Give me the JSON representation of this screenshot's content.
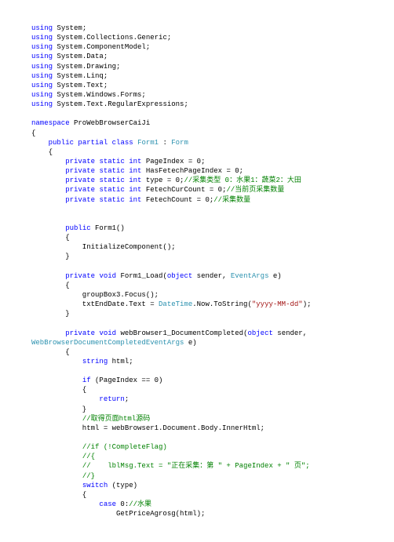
{
  "code": {
    "u1a": "using",
    "u1b": " System;",
    "u2a": "using",
    "u2b": " System.Collections.Generic;",
    "u3a": "using",
    "u3b": " System.ComponentModel;",
    "u4a": "using",
    "u4b": " System.Data;",
    "u5a": "using",
    "u5b": " System.Drawing;",
    "u6a": "using",
    "u6b": " System.Linq;",
    "u7a": "using",
    "u7b": " System.Text;",
    "u8a": "using",
    "u8b": " System.Windows.Forms;",
    "u9a": "using",
    "u9b": " System.Text.RegularExpressions;",
    "ns_a": "namespace",
    "ns_b": " ProWebBrowserCaiJi",
    "ob": "{",
    "cls_1": "    ",
    "cls_2": "public",
    "cls_3": " ",
    "cls_4": "partial",
    "cls_5": " ",
    "cls_6": "class",
    "cls_7": " ",
    "cls_8": "Form1",
    "cls_9": " : ",
    "cls_10": "Form",
    "ob2": "    {",
    "f1_1": "        ",
    "f1_2": "private",
    "f1_3": " ",
    "f1_4": "static",
    "f1_5": " ",
    "f1_6": "int",
    "f1_7": " PageIndex = 0;",
    "f2_1": "        ",
    "f2_2": "private",
    "f2_3": " ",
    "f2_4": "static",
    "f2_5": " ",
    "f2_6": "int",
    "f2_7": " HasFetechPageIndex = 0;",
    "f3_1": "        ",
    "f3_2": "private",
    "f3_3": " ",
    "f3_4": "static",
    "f3_5": " ",
    "f3_6": "int",
    "f3_7": " type = 0;",
    "f3_8": "//采集类型 0：水果1：蔬菜2：大田",
    "f4_1": "        ",
    "f4_2": "private",
    "f4_3": " ",
    "f4_4": "static",
    "f4_5": " ",
    "f4_6": "int",
    "f4_7": " FetechCurCount = 0;",
    "f4_8": "//当前页采集数量",
    "f5_1": "        ",
    "f5_2": "private",
    "f5_3": " ",
    "f5_4": "static",
    "f5_5": " ",
    "f5_6": "int",
    "f5_7": " FetechCount = 0;",
    "f5_8": "//采集数量",
    "ctor_1": "        ",
    "ctor_2": "public",
    "ctor_3": " Form1()",
    "ctor_ob": "        {",
    "ctor_body": "            InitializeComponent();",
    "ctor_cb": "        }",
    "fl_1": "        ",
    "fl_2": "private",
    "fl_3": " ",
    "fl_4": "void",
    "fl_5": " Form1_Load(",
    "fl_6": "object",
    "fl_7": " sender, ",
    "fl_8": "EventArgs",
    "fl_9": " e)",
    "fl_ob": "        {",
    "fl_b1": "            groupBox3.Focus();",
    "fl_b2a": "            txtEndDate.Text = ",
    "fl_b2b": "DateTime",
    "fl_b2c": ".Now.ToString(",
    "fl_b2d": "\"yyyy-MM-dd\"",
    "fl_b2e": ");",
    "fl_cb": "        }",
    "dc_1": "        ",
    "dc_2": "private",
    "dc_3": " ",
    "dc_4": "void",
    "dc_5": " webBrowser1_DocumentCompleted(",
    "dc_6": "object",
    "dc_7": " sender, ",
    "dc_8": "WebBrowserDocumentCompletedEventArgs",
    "dc_9": " e)",
    "dc_ob": "        {",
    "dc_b1a": "            ",
    "dc_b1b": "string",
    "dc_b1c": " html;",
    "dc_if_1": "            ",
    "dc_if_2": "if",
    "dc_if_3": " (PageIndex == 0)",
    "dc_if_ob": "            {",
    "dc_if_ret_1": "                ",
    "dc_if_ret_2": "return",
    "dc_if_ret_3": ";",
    "dc_if_cb": "            }",
    "dc_c1_1": "            ",
    "dc_c1_2": "//取得页面html源码",
    "dc_h1": "            html = webBrowser1.Document.Body.InnerHtml;",
    "dc_c2_1": "            ",
    "dc_c2_2": "//if (!CompleteFlag)",
    "dc_c3_1": "            ",
    "dc_c3_2": "//{",
    "dc_c4_1": "            ",
    "dc_c4_2": "//    lblMsg.Text = \"正在采集：第 \" + PageIndex + \" 页\";",
    "dc_c5_1": "            ",
    "dc_c5_2": "//}",
    "dc_sw_1": "            ",
    "dc_sw_2": "switch",
    "dc_sw_3": " (type)",
    "dc_sw_ob": "            {",
    "dc_case_1": "                ",
    "dc_case_2": "case",
    "dc_case_3": " 0:",
    "dc_case_4": "//水果",
    "dc_call": "                    GetPriceAgrosg(html);"
  }
}
